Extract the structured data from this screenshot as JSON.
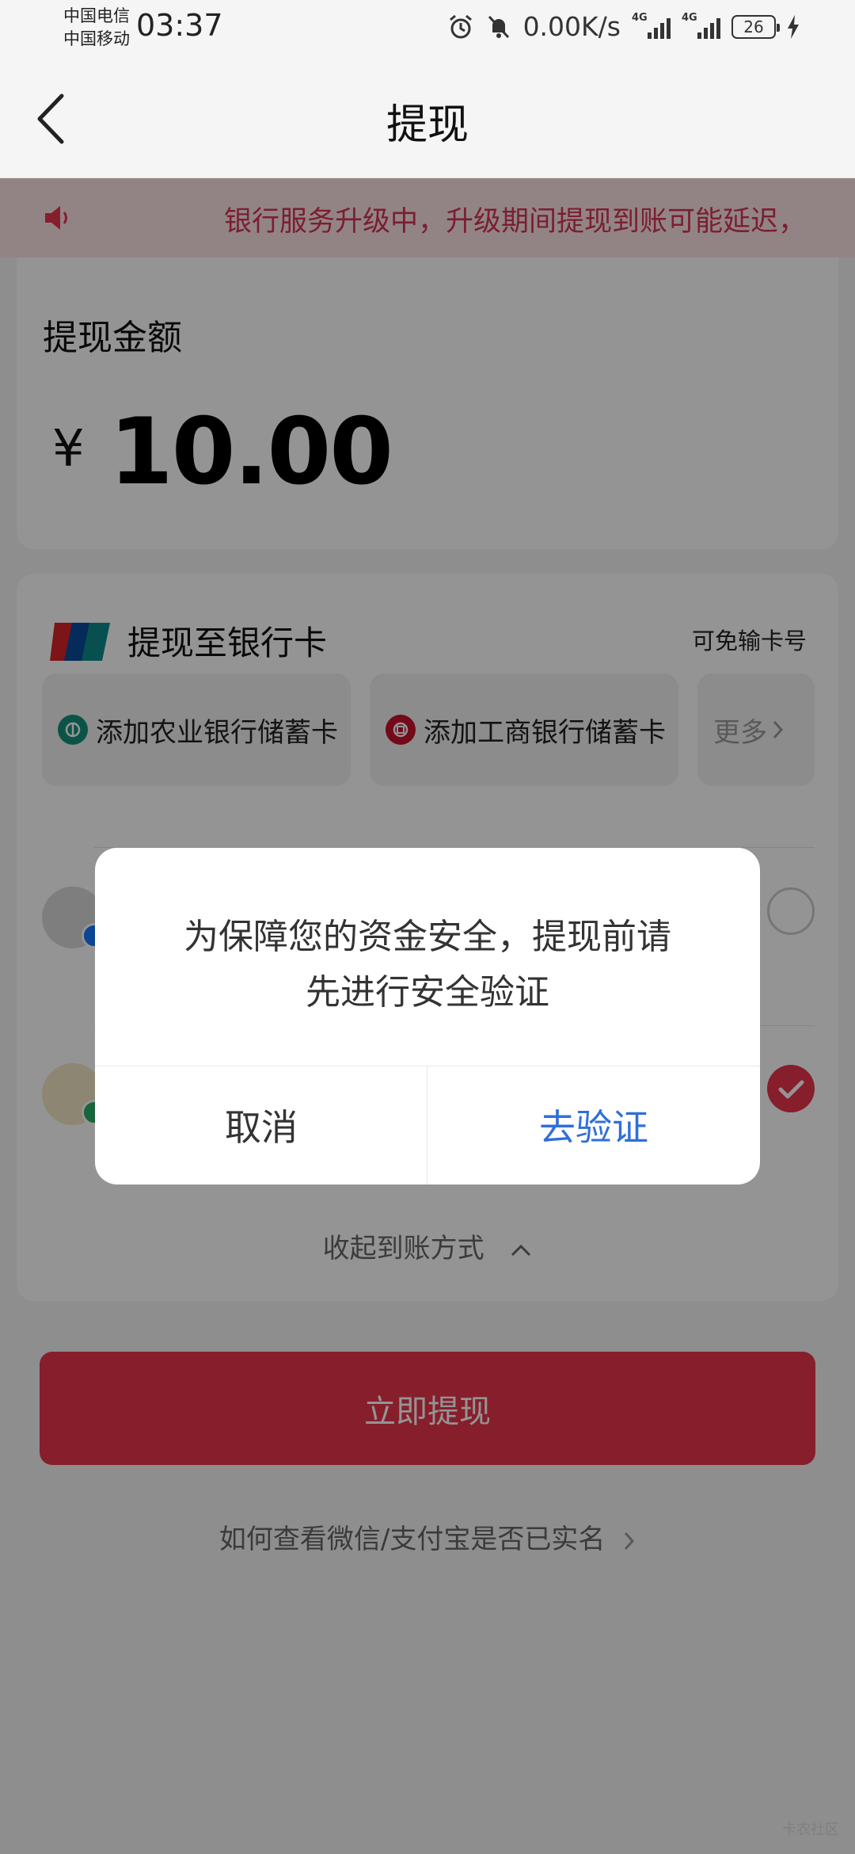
{
  "status_bar": {
    "carrier1": "中国电信",
    "carrier2": "中国移动",
    "time": "03:37",
    "speed": "0.00K/s",
    "network1": "4G",
    "network2": "4G",
    "battery": "26"
  },
  "header": {
    "title": "提现"
  },
  "notice": {
    "text": "银行服务升级中，升级期间提现到账可能延迟，"
  },
  "amount": {
    "label": "提现金额",
    "currency": "¥",
    "value": "10.00"
  },
  "withdraw_to": {
    "title": "提现至银行卡",
    "note": "可免输卡号",
    "banks": [
      {
        "label": "添加农业银行储蓄卡"
      },
      {
        "label": "添加工商银行储蓄卡"
      }
    ],
    "more": "更多",
    "collapse": "收起到账方式"
  },
  "submit": {
    "label": "立即提现"
  },
  "help": {
    "text": "如何查看微信/支付宝是否已实名"
  },
  "watermark": "卡农社区",
  "dialog": {
    "message_line1": "为保障您的资金安全，提现前请",
    "message_line2": "先进行安全验证",
    "cancel": "取消",
    "confirm": "去验证"
  },
  "colors": {
    "accent": "#e8354c",
    "link": "#2f6fd9",
    "notice_text": "#d63554",
    "notice_bg": "#fbe3e6",
    "abc_green": "#16907a",
    "icbc_red": "#c8102e",
    "wechat_green": "#2aae67",
    "alipay_blue": "#1677ff"
  },
  "icons": {
    "back": "back-chevron-icon",
    "notice": "speaker-icon",
    "unionpay": "unionpay-logo-icon",
    "abc": "abc-bank-icon",
    "icbc": "icbc-bank-icon",
    "more": "chevron-right-icon",
    "collapse": "chevron-up-icon",
    "help": "chevron-right-icon"
  }
}
